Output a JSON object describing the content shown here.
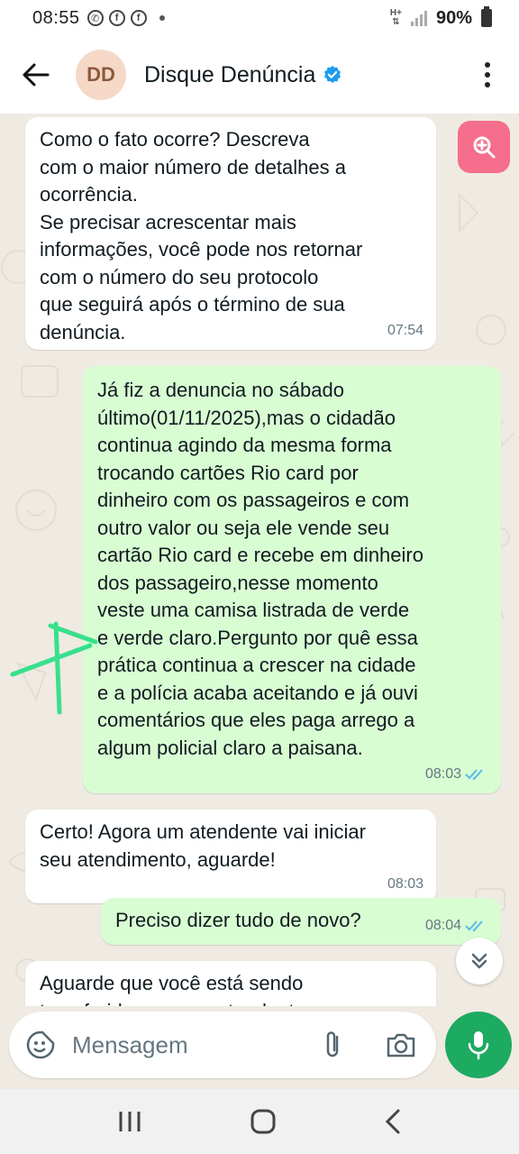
{
  "status_bar": {
    "time": "08:55",
    "network": "H+",
    "battery": "90%"
  },
  "header": {
    "avatar_initials": "DD",
    "contact_name": "Disque Denúncia"
  },
  "messages": [
    {
      "direction": "incoming",
      "text": "Como o fato ocorre? Descreva\ncom o maior número de detalhes a\nocorrência.\nSe precisar acrescentar mais\ninformações,  você pode nos retornar\ncom o número do seu protocolo\nque seguirá após o término de sua\ndenúncia.",
      "time": "07:54"
    },
    {
      "direction": "outgoing",
      "text": "Já fiz a denuncia no sábado\núltimo(01/11/2025),mas o cidadão\ncontinua agindo da mesma forma\ntrocando cartões Rio card por\ndinheiro com os passageiros e com\noutro valor ou seja ele vende seu\ncartão Rio card e recebe em dinheiro\ndos passageiro,nesse momento\nveste uma camisa listrada de verde\ne verde claro.Pergunto por quê essa\nprática continua a crescer na cidade\ne a polícia acaba aceitando e já ouvi\ncomentários que eles paga arrego a\nalgum policial claro a paisana.",
      "time": "08:03"
    },
    {
      "direction": "incoming",
      "text": "Certo! Agora um atendente vai iniciar\nseu atendimento, aguarde!",
      "time": "08:03"
    },
    {
      "direction": "outgoing",
      "text": "Preciso dizer tudo de novo?",
      "time": "08:04"
    },
    {
      "direction": "incoming",
      "text": "Aguarde que você está sendo\ntransferido para um atendente",
      "time": ""
    }
  ],
  "composer": {
    "placeholder": "Mensagem"
  },
  "colors": {
    "incoming_bubble": "#ffffff",
    "outgoing_bubble": "#d9fdd3",
    "accent_green": "#1daa61",
    "read_ticks": "#53bdeb",
    "zoom_button": "#f56e8c"
  },
  "icons": {
    "back": "arrow-left-icon",
    "verified": "verified-badge-icon",
    "menu": "more-vertical-icon",
    "zoom": "zoom-in-icon",
    "scroll": "double-chevron-down-icon",
    "sticker": "sticker-icon",
    "attach": "paperclip-icon",
    "camera": "camera-icon",
    "mic": "microphone-icon"
  }
}
